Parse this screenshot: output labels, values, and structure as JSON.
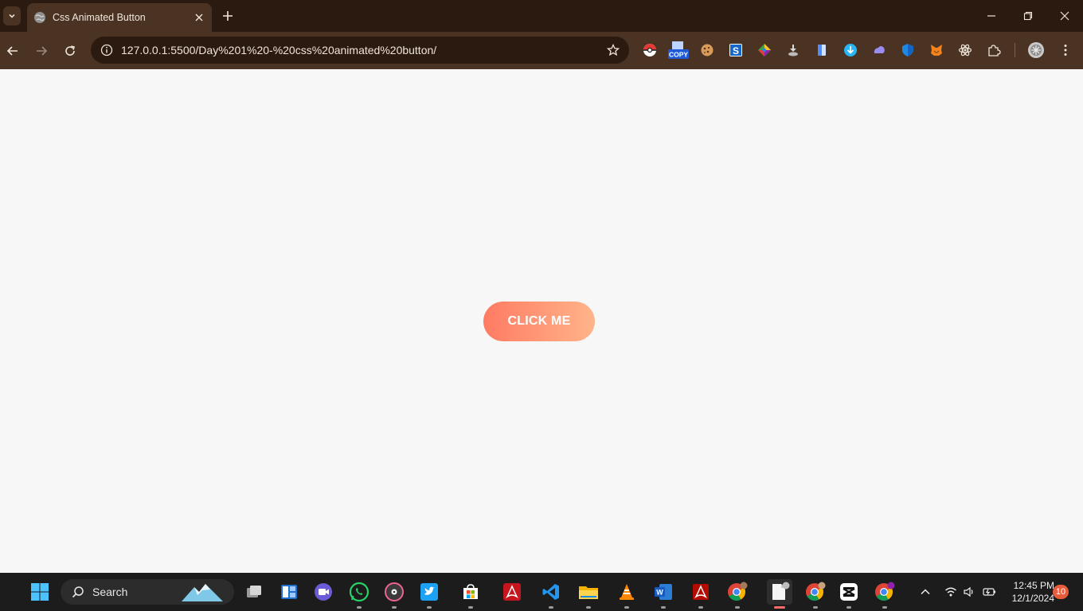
{
  "browser": {
    "tab": {
      "title": "Css Animated Button"
    },
    "address_bar": {
      "url": "127.0.0.1:5500/Day%201%20-%20css%20animated%20button/"
    },
    "extensions": [
      {
        "name": "pokeball-icon"
      },
      {
        "name": "copy-extension-icon",
        "label": "COPY"
      },
      {
        "name": "cookie-icon"
      },
      {
        "name": "s-extension-icon"
      },
      {
        "name": "color-wheel-icon"
      },
      {
        "name": "download-helper-icon"
      },
      {
        "name": "docs-icon"
      },
      {
        "name": "download-arrow-icon"
      },
      {
        "name": "cloud-icon"
      },
      {
        "name": "shield-icon"
      },
      {
        "name": "metamask-fox-icon"
      },
      {
        "name": "react-devtools-icon"
      },
      {
        "name": "puzzle-extensions-icon"
      }
    ]
  },
  "page": {
    "button_label": "CLICK ME"
  },
  "taskbar": {
    "search_label": "Search",
    "clock_time": "12:45 PM",
    "clock_date": "12/1/2024",
    "notification_count": "10"
  },
  "colors": {
    "chrome_dark": "#2b1a0f",
    "chrome_toolbar": "#4a3323",
    "button_gradient_start": "#ff7b63",
    "button_gradient_end": "#ffb48a",
    "page_background": "#f7f7f7"
  }
}
